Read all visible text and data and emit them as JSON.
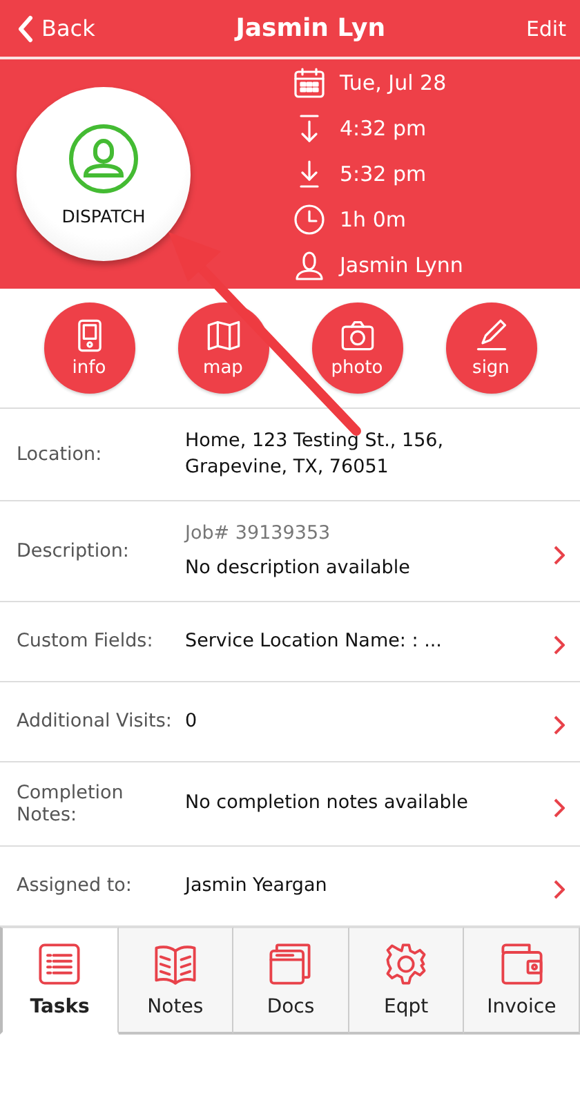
{
  "nav": {
    "back": "Back",
    "title": "Jasmin Lyn",
    "edit": "Edit"
  },
  "status_button": {
    "label": "DISPATCH"
  },
  "schedule": [
    {
      "kind": "date",
      "text": "Tue, Jul 28"
    },
    {
      "kind": "start",
      "text": "4:32 pm"
    },
    {
      "kind": "end",
      "text": "5:32 pm"
    },
    {
      "kind": "duration",
      "text": "1h 0m"
    },
    {
      "kind": "person",
      "text": "Jasmin Lynn"
    }
  ],
  "actions": [
    {
      "kind": "info",
      "label": "info"
    },
    {
      "kind": "map",
      "label": "map"
    },
    {
      "kind": "photo",
      "label": "photo"
    },
    {
      "kind": "sign",
      "label": "sign"
    }
  ],
  "fields": [
    {
      "label": "Location:",
      "lines": [
        "Home, 123 Testing St., 156, Grapevine, TX, 76051"
      ],
      "chevron": false
    },
    {
      "label": "Description:",
      "sub": "Job# 39139353",
      "lines": [
        "No description available"
      ],
      "chevron": true
    },
    {
      "label": "Custom Fields:",
      "lines": [
        "Service Location Name: : ..."
      ],
      "chevron": true
    },
    {
      "label": "Additional Visits:",
      "lines": [
        "0"
      ],
      "chevron": true
    },
    {
      "label": "Completion Notes:",
      "lines": [
        "No completion notes available"
      ],
      "chevron": true
    },
    {
      "label": "Assigned to:",
      "lines": [
        "Jasmin Yeargan"
      ],
      "chevron": true
    }
  ],
  "tabs": [
    {
      "kind": "tasks",
      "label": "Tasks",
      "selected": true
    },
    {
      "kind": "notes",
      "label": "Notes",
      "selected": false
    },
    {
      "kind": "docs",
      "label": "Docs",
      "selected": false
    },
    {
      "kind": "eqpt",
      "label": "Eqpt",
      "selected": false
    },
    {
      "kind": "invoice",
      "label": "Invoice",
      "selected": false
    }
  ]
}
